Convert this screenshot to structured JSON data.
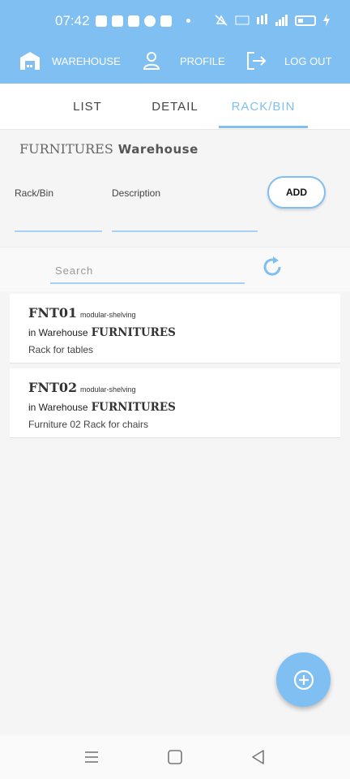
{
  "status_bar": {
    "time": "07:42"
  },
  "header": {
    "warehouse_label": "WAREHOUSE",
    "profile_label": "PROFILE",
    "logout_label": "LOG OUT",
    "accent_color": "#7fbff2",
    "icons": [
      "warehouse-icon",
      "profile-icon",
      "logout-icon"
    ]
  },
  "tabs": [
    {
      "label": "LIST",
      "active": false
    },
    {
      "label": "DETAIL",
      "active": false
    },
    {
      "label": "RACK/BIN",
      "active": true
    }
  ],
  "page": {
    "warehouse_name": "FURNITURES",
    "warehouse_word": "Warehouse"
  },
  "form": {
    "rackbin_label": "Rack/Bin",
    "rackbin_value": "",
    "description_label": "Description",
    "description_value": "",
    "add_label": "ADD"
  },
  "search": {
    "placeholder": "Search",
    "value": ""
  },
  "items": [
    {
      "code": "FNT01",
      "type": "modular-shelving",
      "in_label": "in Warehouse",
      "warehouse": "FURNITURES",
      "description": "Rack for tables"
    },
    {
      "code": "FNT02",
      "type": "modular-shelving",
      "in_label": "in Warehouse",
      "warehouse": "FURNITURES",
      "description": "Furniture 02 Rack for chairs"
    }
  ],
  "fab": {
    "icon": "plus-circle-icon"
  },
  "system_nav": {
    "icons": [
      "menu-icon",
      "home-icon",
      "back-icon"
    ]
  }
}
